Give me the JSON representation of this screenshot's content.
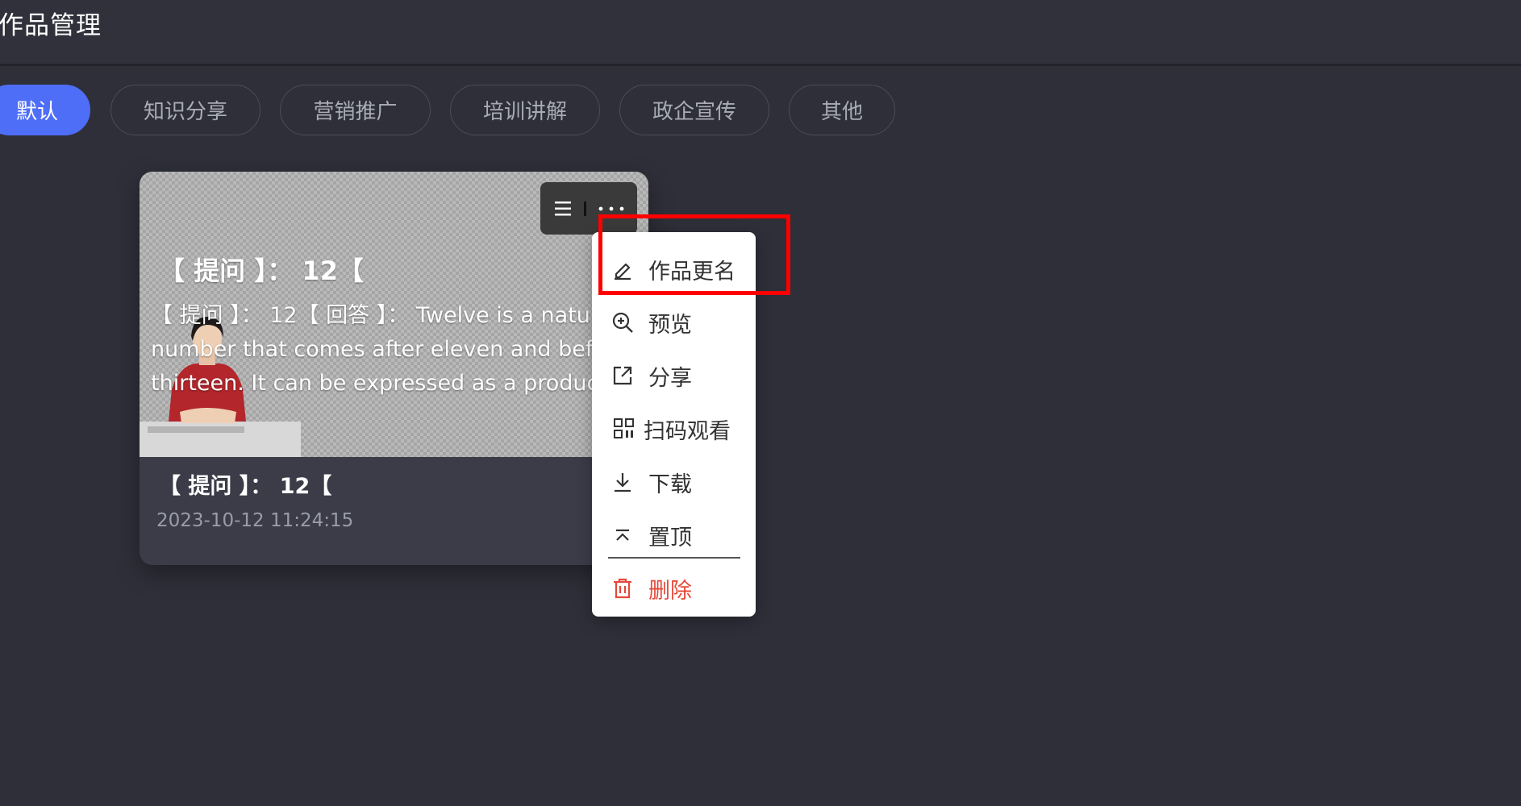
{
  "header": {
    "title": "作品管理"
  },
  "tabs": [
    {
      "label": "默认",
      "active": true
    },
    {
      "label": "知识分享",
      "active": false
    },
    {
      "label": "营销推广",
      "active": false
    },
    {
      "label": "培训讲解",
      "active": false
    },
    {
      "label": "政企宣传",
      "active": false
    },
    {
      "label": "其他",
      "active": false
    }
  ],
  "card": {
    "thumbnail_title": "【 提问 】： 12【",
    "caption_lines": [
      "【 提问 】： 12【 回答 】： Twelve is a natu",
      "number that comes after eleven and befo",
      "thirteen. It can be expressed as a product"
    ],
    "name": "【 提问 】： 12【",
    "date": "2023-10-12 11:24:15",
    "more_icons": [
      "list-icon",
      "cursor-icon",
      "ellipsis-icon"
    ]
  },
  "menu": {
    "items": [
      {
        "label": "作品更名",
        "icon": "edit-icon"
      },
      {
        "label": "预览",
        "icon": "zoom-in-icon"
      },
      {
        "label": "分享",
        "icon": "share-icon"
      },
      {
        "label": "扫码观看",
        "icon": "qrcode-icon"
      },
      {
        "label": "下载",
        "icon": "download-icon"
      },
      {
        "label": "置顶",
        "icon": "pin-top-icon"
      },
      {
        "label": "删除",
        "icon": "trash-icon",
        "danger": true
      }
    ]
  },
  "colors": {
    "background": "#2e2f39",
    "accent": "#4f6ef7",
    "danger": "#e5493a",
    "highlight": "#ff0000"
  }
}
